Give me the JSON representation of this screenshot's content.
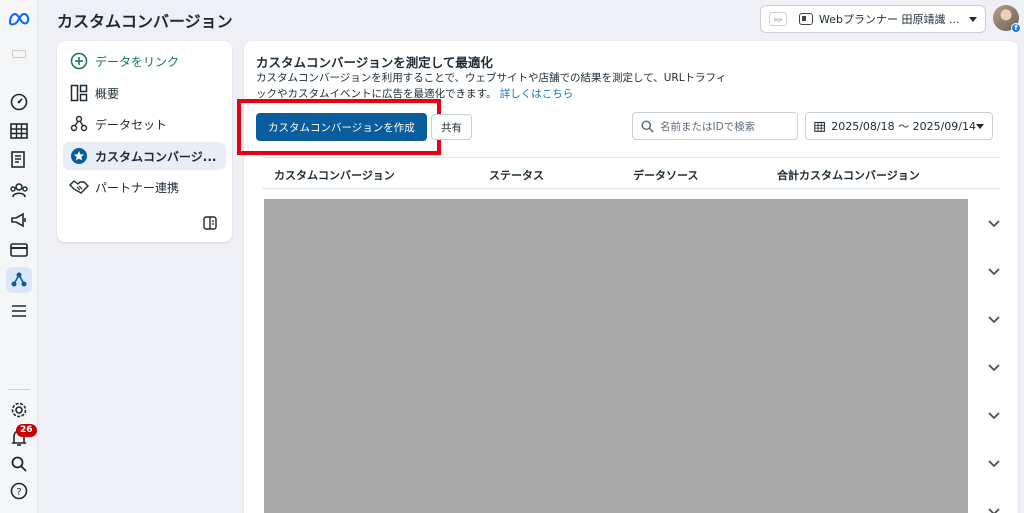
{
  "header": {
    "title": "カスタムコンバージョン",
    "account_name": "Webプランナー 田原靖識 ...",
    "account_logo_text": "logo"
  },
  "rail": {
    "notification_count": "26"
  },
  "sidebar": {
    "items": [
      {
        "label": "データをリンク",
        "icon": "plus-circle-icon"
      },
      {
        "label": "概要",
        "icon": "overview-icon"
      },
      {
        "label": "データセット",
        "icon": "dataset-icon"
      },
      {
        "label": "カスタムコンバージ...",
        "icon": "star-icon"
      },
      {
        "label": "パートナー連携",
        "icon": "handshake-icon"
      }
    ]
  },
  "main": {
    "title": "カスタムコンバージョンを測定して最適化",
    "description": "カスタムコンバージョンを利用することで、ウェブサイトや店舗での結果を測定して、URLトラフィックやカスタムイベントに広告を最適化できます。",
    "learn_more": "詳しくはこちら",
    "create_button": "カスタムコンバージョンを作成",
    "share_button": "共有",
    "search_placeholder": "名前またはIDで検索",
    "date_range": "2025/08/18 〜 2025/09/14",
    "columns": [
      "カスタムコンバージョン",
      "ステータス",
      "データソース",
      "合計カスタムコンバージョン"
    ]
  },
  "colors": {
    "primary": "#0a5d9c",
    "link": "#0a78be",
    "highlight": "#e60012",
    "redacted": "#a9a9a9"
  }
}
